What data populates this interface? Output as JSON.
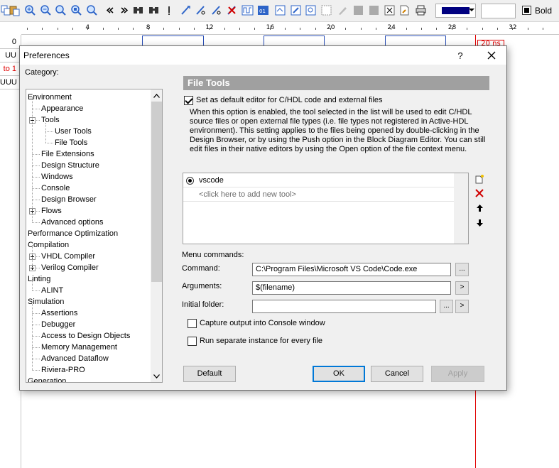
{
  "toolbar": {
    "bold_label": "Bold",
    "color_swatch_value": "#000080",
    "width_value": ""
  },
  "ruler": {
    "labels": [
      "4",
      "8",
      "12",
      "16",
      "20",
      "24",
      "28",
      "32"
    ]
  },
  "left_rows": [
    {
      "text": "0",
      "color": "#000000"
    },
    {
      "text": "UU",
      "color": "#000000"
    },
    {
      "text": "to 1",
      "color": "#e00000"
    },
    {
      "text": "UUU",
      "color": "#000000"
    }
  ],
  "cursor_label": "20 ns",
  "dialog": {
    "title": "Preferences",
    "help": "?",
    "category_label": "Category:",
    "tree": [
      "Environment",
      "Appearance",
      "Tools",
      "User Tools",
      "File Tools",
      "File Extensions",
      "Design Structure",
      "Windows",
      "Console",
      "Design Browser",
      "Flows",
      "Advanced options",
      "Performance Optimization",
      "Compilation",
      "VHDL Compiler",
      "Verilog Compiler",
      "Linting",
      "ALINT",
      "Simulation",
      "Assertions",
      "Debugger",
      "Access to Design Objects",
      "Memory Management",
      "Advanced Dataflow",
      "Riviera-PRO",
      "Generation"
    ],
    "section_title": "File Tools",
    "default_editor_label": "Set as default editor for C/HDL code and external files",
    "default_editor_checked": true,
    "description": "When this option is enabled, the tool selected in the list will be used to edit C/HDL source files or open external file types (i.e. file types not registered in Active-HDL environment). This setting applies to the files being opened by double-clicking in the Design Browser, or by using the Push option in the Block Diagram Editor. You can still edit files in their native editors by using the Open option of the file context menu.",
    "tools": [
      "vscode"
    ],
    "add_tool_placeholder": "<click here to add new tool>",
    "menu_commands_label": "Menu commands:",
    "command_label": "Command:",
    "command_value": "C:\\Program Files\\Microsoft VS Code\\Code.exe",
    "arguments_label": "Arguments:",
    "arguments_value": "$(filename)",
    "initial_folder_label": "Initial folder:",
    "initial_folder_value": "",
    "browse_label": "...",
    "arrow_label": ">",
    "capture_output_label": "Capture output into Console window",
    "capture_output_checked": false,
    "separate_instance_label": "Run separate instance for every file",
    "separate_instance_checked": false,
    "buttons": {
      "default": "Default",
      "ok": "OK",
      "cancel": "Cancel",
      "apply": "Apply"
    }
  }
}
